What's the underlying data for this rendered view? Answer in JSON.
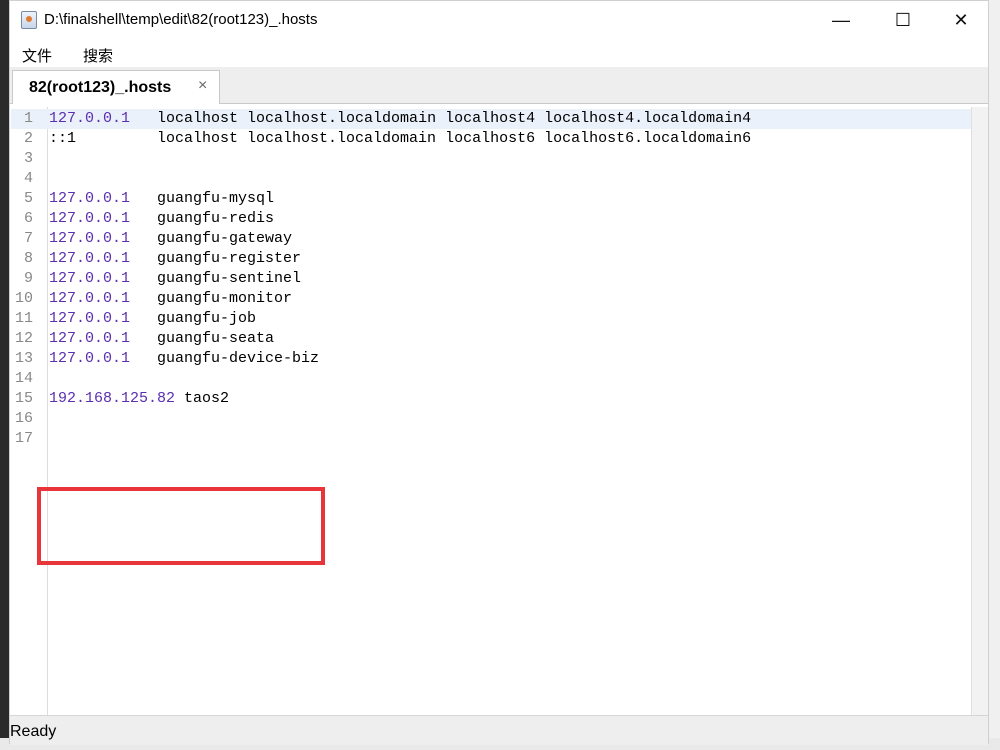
{
  "window": {
    "title": "D:\\finalshell\\temp\\edit\\82(root123)_.hosts",
    "controls": {
      "minimize": "—",
      "maximize": "☐",
      "close": "✕"
    }
  },
  "menu": [
    "文件",
    "搜索"
  ],
  "tabs": [
    {
      "label": "82(root123)_.hosts",
      "close": "×",
      "active": true
    }
  ],
  "editor": {
    "lines": [
      {
        "num": "1",
        "ip": "127.0.0.1",
        "rest": "   localhost localhost.localdomain localhost4 localhost4.localdomain4"
      },
      {
        "num": "2",
        "ip": "",
        "rest": "::1         localhost localhost.localdomain localhost6 localhost6.localdomain6"
      },
      {
        "num": "3",
        "ip": "",
        "rest": ""
      },
      {
        "num": "4",
        "ip": "",
        "rest": ""
      },
      {
        "num": "5",
        "ip": "127.0.0.1",
        "rest": "   guangfu-mysql"
      },
      {
        "num": "6",
        "ip": "127.0.0.1",
        "rest": "   guangfu-redis"
      },
      {
        "num": "7",
        "ip": "127.0.0.1",
        "rest": "   guangfu-gateway"
      },
      {
        "num": "8",
        "ip": "127.0.0.1",
        "rest": "   guangfu-register"
      },
      {
        "num": "9",
        "ip": "127.0.0.1",
        "rest": "   guangfu-sentinel"
      },
      {
        "num": "10",
        "ip": "127.0.0.1",
        "rest": "   guangfu-monitor"
      },
      {
        "num": "11",
        "ip": "127.0.0.1",
        "rest": "   guangfu-job"
      },
      {
        "num": "12",
        "ip": "127.0.0.1",
        "rest": "   guangfu-seata"
      },
      {
        "num": "13",
        "ip": "127.0.0.1",
        "rest": "   guangfu-device-biz"
      },
      {
        "num": "14",
        "ip": "",
        "rest": ""
      },
      {
        "num": "15",
        "ip": "192.168.125.82",
        "rest": " taos2"
      },
      {
        "num": "16",
        "ip": "",
        "rest": ""
      },
      {
        "num": "17",
        "ip": "",
        "rest": ""
      }
    ]
  },
  "status": "Ready",
  "colors": {
    "ip": "#5b2fb0",
    "highlight_box": "#e8353a",
    "current_line": "#eaf1fb"
  },
  "icons": {
    "app": "java-app-icon"
  }
}
